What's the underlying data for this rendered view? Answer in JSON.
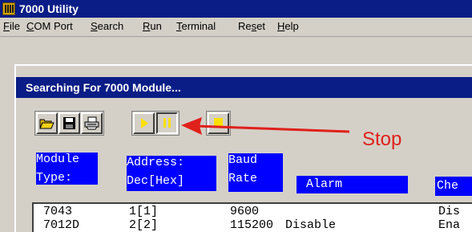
{
  "window": {
    "title": "7000 Utility"
  },
  "menu": [
    {
      "hotkey": "F",
      "rest": "ile"
    },
    {
      "hotkey": "C",
      "rest": "OM Port"
    },
    {
      "hotkey": "S",
      "rest": "earch"
    },
    {
      "hotkey": "R",
      "rest": "un"
    },
    {
      "hotkey": "T",
      "rest": "erminal"
    },
    {
      "pre": "Re",
      "hotkey": "s",
      "rest": "et"
    },
    {
      "hotkey": "H",
      "rest": "elp"
    }
  ],
  "dialog": {
    "title": "Searching For 7000 Module..."
  },
  "toolbar": {
    "open_icon": "folder-open-icon",
    "save_icon": "floppy-disk-icon",
    "print_icon": "printer-icon",
    "run_icon": "play-icon",
    "pause_icon": "pause-icon",
    "stop_icon": "stop-icon"
  },
  "annotation": {
    "label": "Stop",
    "color": "#e0201b"
  },
  "table": {
    "headers": [
      {
        "line1": "Module",
        "line2": "Type:"
      },
      {
        "line1": "Address:",
        "line2": "Dec[Hex]"
      },
      {
        "line1": "Baud",
        "line2": "Rate"
      },
      {
        "line1": "",
        "line2": "Alarm"
      },
      {
        "line1": "",
        "line2": "Che"
      }
    ],
    "rows": [
      {
        "type": "7043",
        "address": "1[1]",
        "baud": "9600",
        "alarm": "",
        "check": "Dis"
      },
      {
        "type": "7012D",
        "address": "2[2]",
        "baud": "115200",
        "alarm": "Disable",
        "check": "Ena"
      }
    ]
  },
  "colors": {
    "titlebar": "#0a1d86",
    "header_bg": "#0000ff",
    "face": "#d4d0c8"
  }
}
